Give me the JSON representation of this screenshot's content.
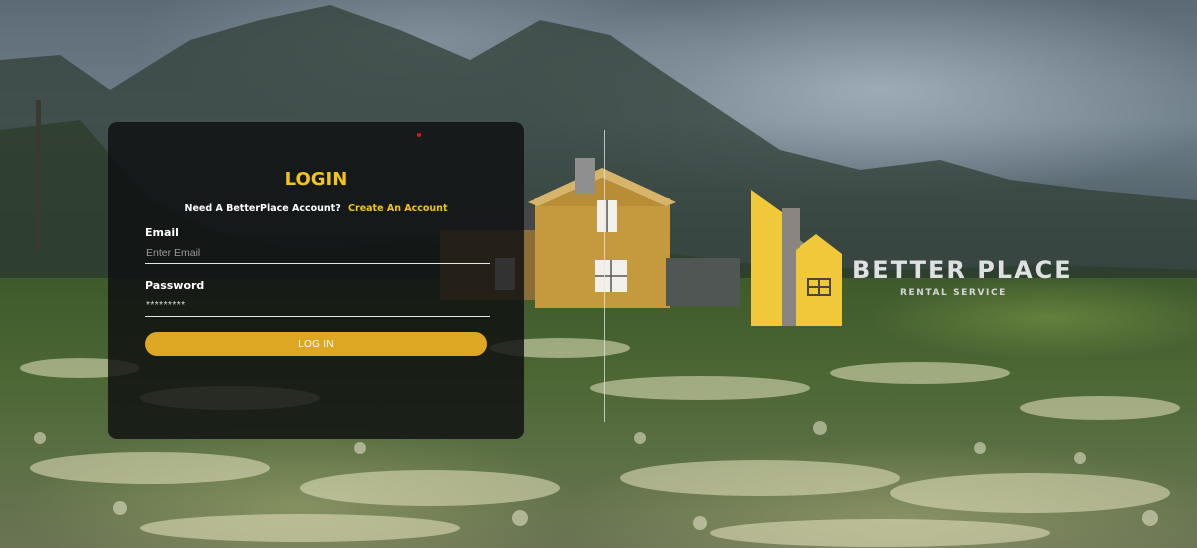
{
  "login": {
    "title": "LOGIN",
    "prompt": "Need A BetterPlace Account?",
    "create_link": "Create An Account",
    "email_label": "Email",
    "email_placeholder": "Enter Email",
    "email_value": "",
    "password_label": "Password",
    "password_value": "*********",
    "button_label": "LOG IN"
  },
  "brand": {
    "name": "BETTER PLACE",
    "tagline": "RENTAL SERVICE"
  },
  "colors": {
    "accent": "#f2c41c",
    "button": "#dda623",
    "card_background": "#0e0f10",
    "logo_yellow": "#f0c93a",
    "logo_gray": "#8a8580"
  },
  "icons": {
    "logo": "house-logo-icon",
    "status_dot": "red-dot-icon"
  }
}
